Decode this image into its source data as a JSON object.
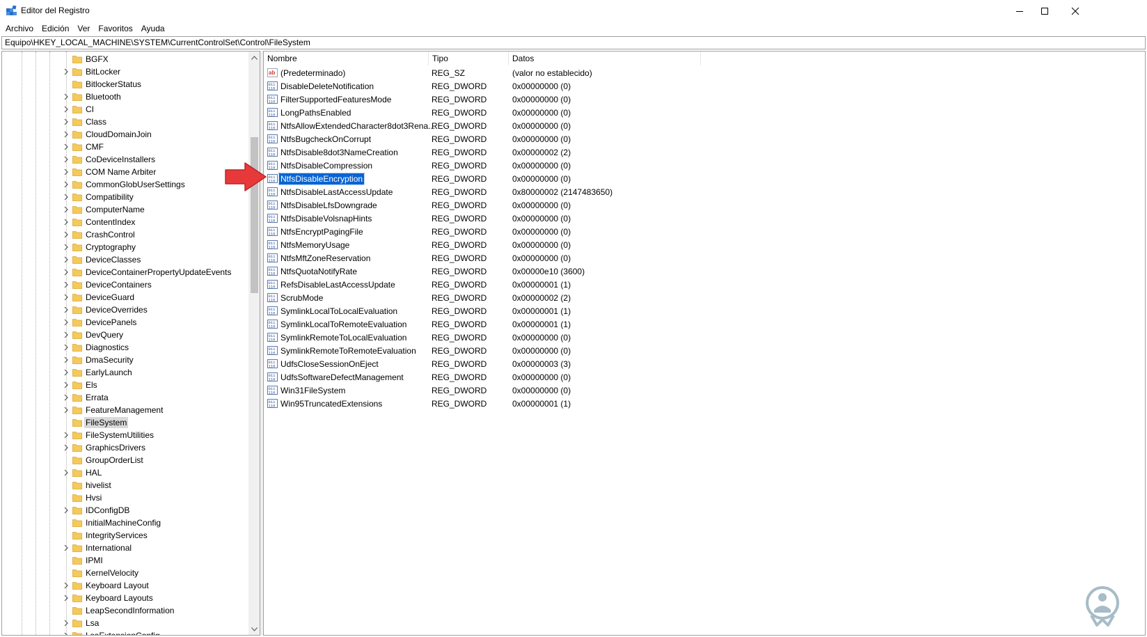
{
  "window": {
    "title": "Editor del Registro",
    "icon": "regedit-icon",
    "controls": [
      "minimize-icon",
      "maximize-icon",
      "close-icon"
    ]
  },
  "menu": [
    "Archivo",
    "Edición",
    "Ver",
    "Favoritos",
    "Ayuda"
  ],
  "address": "Equipo\\HKEY_LOCAL_MACHINE\\SYSTEM\\CurrentControlSet\\Control\\FileSystem",
  "tree": {
    "items": [
      {
        "label": "BGFX",
        "expandable": false
      },
      {
        "label": "BitLocker",
        "expandable": true
      },
      {
        "label": "BitlockerStatus",
        "expandable": false
      },
      {
        "label": "Bluetooth",
        "expandable": true
      },
      {
        "label": "CI",
        "expandable": true
      },
      {
        "label": "Class",
        "expandable": true
      },
      {
        "label": "CloudDomainJoin",
        "expandable": true
      },
      {
        "label": "CMF",
        "expandable": true
      },
      {
        "label": "CoDeviceInstallers",
        "expandable": true
      },
      {
        "label": "COM Name Arbiter",
        "expandable": true
      },
      {
        "label": "CommonGlobUserSettings",
        "expandable": true
      },
      {
        "label": "Compatibility",
        "expandable": true
      },
      {
        "label": "ComputerName",
        "expandable": true
      },
      {
        "label": "ContentIndex",
        "expandable": true
      },
      {
        "label": "CrashControl",
        "expandable": true
      },
      {
        "label": "Cryptography",
        "expandable": true
      },
      {
        "label": "DeviceClasses",
        "expandable": true
      },
      {
        "label": "DeviceContainerPropertyUpdateEvents",
        "expandable": true
      },
      {
        "label": "DeviceContainers",
        "expandable": true
      },
      {
        "label": "DeviceGuard",
        "expandable": true
      },
      {
        "label": "DeviceOverrides",
        "expandable": true
      },
      {
        "label": "DevicePanels",
        "expandable": true
      },
      {
        "label": "DevQuery",
        "expandable": true
      },
      {
        "label": "Diagnostics",
        "expandable": true
      },
      {
        "label": "DmaSecurity",
        "expandable": true
      },
      {
        "label": "EarlyLaunch",
        "expandable": true
      },
      {
        "label": "Els",
        "expandable": true
      },
      {
        "label": "Errata",
        "expandable": true
      },
      {
        "label": "FeatureManagement",
        "expandable": true
      },
      {
        "label": "FileSystem",
        "expandable": false,
        "selected": true
      },
      {
        "label": "FileSystemUtilities",
        "expandable": true
      },
      {
        "label": "GraphicsDrivers",
        "expandable": true
      },
      {
        "label": "GroupOrderList",
        "expandable": false
      },
      {
        "label": "HAL",
        "expandable": true
      },
      {
        "label": "hivelist",
        "expandable": false
      },
      {
        "label": "Hvsi",
        "expandable": false
      },
      {
        "label": "IDConfigDB",
        "expandable": true
      },
      {
        "label": "InitialMachineConfig",
        "expandable": false
      },
      {
        "label": "IntegrityServices",
        "expandable": false
      },
      {
        "label": "International",
        "expandable": true
      },
      {
        "label": "IPMI",
        "expandable": false
      },
      {
        "label": "KernelVelocity",
        "expandable": false
      },
      {
        "label": "Keyboard Layout",
        "expandable": true
      },
      {
        "label": "Keyboard Layouts",
        "expandable": true
      },
      {
        "label": "LeapSecondInformation",
        "expandable": false
      },
      {
        "label": "Lsa",
        "expandable": true
      },
      {
        "label": "LsaExtensionConfig",
        "expandable": true
      }
    ]
  },
  "list": {
    "columns": [
      "Nombre",
      "Tipo",
      "Datos"
    ],
    "rows": [
      {
        "name": "(Predeterminado)",
        "type": "REG_SZ",
        "data": "(valor no establecido)",
        "icon": "string-value-icon"
      },
      {
        "name": "DisableDeleteNotification",
        "type": "REG_DWORD",
        "data": "0x00000000 (0)",
        "icon": "dword-value-icon"
      },
      {
        "name": "FilterSupportedFeaturesMode",
        "type": "REG_DWORD",
        "data": "0x00000000 (0)",
        "icon": "dword-value-icon"
      },
      {
        "name": "LongPathsEnabled",
        "type": "REG_DWORD",
        "data": "0x00000000 (0)",
        "icon": "dword-value-icon"
      },
      {
        "name": "NtfsAllowExtendedCharacter8dot3Rena...",
        "type": "REG_DWORD",
        "data": "0x00000000 (0)",
        "icon": "dword-value-icon"
      },
      {
        "name": "NtfsBugcheckOnCorrupt",
        "type": "REG_DWORD",
        "data": "0x00000000 (0)",
        "icon": "dword-value-icon"
      },
      {
        "name": "NtfsDisable8dot3NameCreation",
        "type": "REG_DWORD",
        "data": "0x00000002 (2)",
        "icon": "dword-value-icon"
      },
      {
        "name": "NtfsDisableCompression",
        "type": "REG_DWORD",
        "data": "0x00000000 (0)",
        "icon": "dword-value-icon"
      },
      {
        "name": "NtfsDisableEncryption",
        "type": "REG_DWORD",
        "data": "0x00000000 (0)",
        "icon": "dword-value-icon",
        "selected": true
      },
      {
        "name": "NtfsDisableLastAccessUpdate",
        "type": "REG_DWORD",
        "data": "0x80000002 (2147483650)",
        "icon": "dword-value-icon"
      },
      {
        "name": "NtfsDisableLfsDowngrade",
        "type": "REG_DWORD",
        "data": "0x00000000 (0)",
        "icon": "dword-value-icon"
      },
      {
        "name": "NtfsDisableVolsnapHints",
        "type": "REG_DWORD",
        "data": "0x00000000 (0)",
        "icon": "dword-value-icon"
      },
      {
        "name": "NtfsEncryptPagingFile",
        "type": "REG_DWORD",
        "data": "0x00000000 (0)",
        "icon": "dword-value-icon"
      },
      {
        "name": "NtfsMemoryUsage",
        "type": "REG_DWORD",
        "data": "0x00000000 (0)",
        "icon": "dword-value-icon"
      },
      {
        "name": "NtfsMftZoneReservation",
        "type": "REG_DWORD",
        "data": "0x00000000 (0)",
        "icon": "dword-value-icon"
      },
      {
        "name": "NtfsQuotaNotifyRate",
        "type": "REG_DWORD",
        "data": "0x00000e10 (3600)",
        "icon": "dword-value-icon"
      },
      {
        "name": "RefsDisableLastAccessUpdate",
        "type": "REG_DWORD",
        "data": "0x00000001 (1)",
        "icon": "dword-value-icon"
      },
      {
        "name": "ScrubMode",
        "type": "REG_DWORD",
        "data": "0x00000002 (2)",
        "icon": "dword-value-icon"
      },
      {
        "name": "SymlinkLocalToLocalEvaluation",
        "type": "REG_DWORD",
        "data": "0x00000001 (1)",
        "icon": "dword-value-icon"
      },
      {
        "name": "SymlinkLocalToRemoteEvaluation",
        "type": "REG_DWORD",
        "data": "0x00000001 (1)",
        "icon": "dword-value-icon"
      },
      {
        "name": "SymlinkRemoteToLocalEvaluation",
        "type": "REG_DWORD",
        "data": "0x00000000 (0)",
        "icon": "dword-value-icon"
      },
      {
        "name": "SymlinkRemoteToRemoteEvaluation",
        "type": "REG_DWORD",
        "data": "0x00000000 (0)",
        "icon": "dword-value-icon"
      },
      {
        "name": "UdfsCloseSessionOnEject",
        "type": "REG_DWORD",
        "data": "0x00000003 (3)",
        "icon": "dword-value-icon"
      },
      {
        "name": "UdfsSoftwareDefectManagement",
        "type": "REG_DWORD",
        "data": "0x00000000 (0)",
        "icon": "dword-value-icon"
      },
      {
        "name": "Win31FileSystem",
        "type": "REG_DWORD",
        "data": "0x00000000 (0)",
        "icon": "dword-value-icon"
      },
      {
        "name": "Win95TruncatedExtensions",
        "type": "REG_DWORD",
        "data": "0x00000001 (1)",
        "icon": "dword-value-icon"
      }
    ]
  },
  "colors": {
    "selection": "#0a64d2",
    "tree_selection": "#d9d9d9",
    "folder": "#f5c95a",
    "annotation_arrow": "#e8393a",
    "watermark": "#a7bcc7"
  },
  "annotation": {
    "icon": "red-arrow-icon"
  },
  "watermark": {
    "icon": "solvetic-logo-icon"
  }
}
